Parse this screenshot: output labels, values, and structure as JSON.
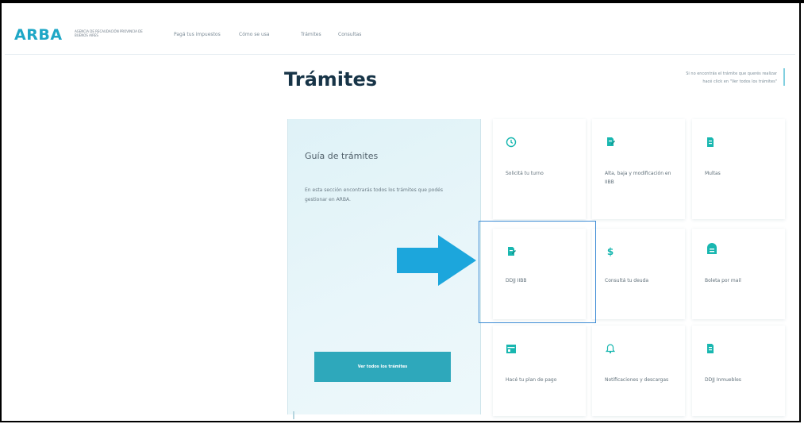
{
  "brand": {
    "logo": "ARBA",
    "subtitle": "AGENCIA DE RECAUDACIÓN PROVINCIA DE BUENOS AIRES",
    "accent": "#1ea7c6"
  },
  "nav": [
    "Pagá tus impuestos",
    "Cómo se usa",
    "Trámites",
    "Consultas"
  ],
  "page": {
    "title": "Trámites",
    "help_line1": "Si no encontrás el trámite que querés realizar",
    "help_line2": "hacé click en \"Ver todos los trámites\""
  },
  "guide": {
    "title": "Guía de trámites",
    "description": "En esta sección encontrarás todos los trámites que podés gestionar en ARBA.",
    "button": "Ver todos los trámites"
  },
  "cards": [
    {
      "label": "Solicitá tu turno",
      "icon": "clock-icon"
    },
    {
      "label": "Alta, baja y modificación en IIBB",
      "icon": "document-edit-icon"
    },
    {
      "label": "Multas",
      "icon": "document-icon"
    },
    {
      "label": "DDJJ IIBB",
      "icon": "document-edit-icon"
    },
    {
      "label": "Consultá tu deuda",
      "icon": "dollar-icon"
    },
    {
      "label": "Boleta por mail",
      "icon": "mailbox-icon"
    },
    {
      "label": "Hacé tu plan de pago",
      "icon": "calendar-icon"
    },
    {
      "label": "Notificaciones y descargas",
      "icon": "bell-icon"
    },
    {
      "label": "DDJJ Inmuebles",
      "icon": "document-icon"
    }
  ],
  "colors": {
    "icon": "#19b7b0",
    "arrow": "#1ca6dc",
    "highlight": "#3c8bd4"
  }
}
